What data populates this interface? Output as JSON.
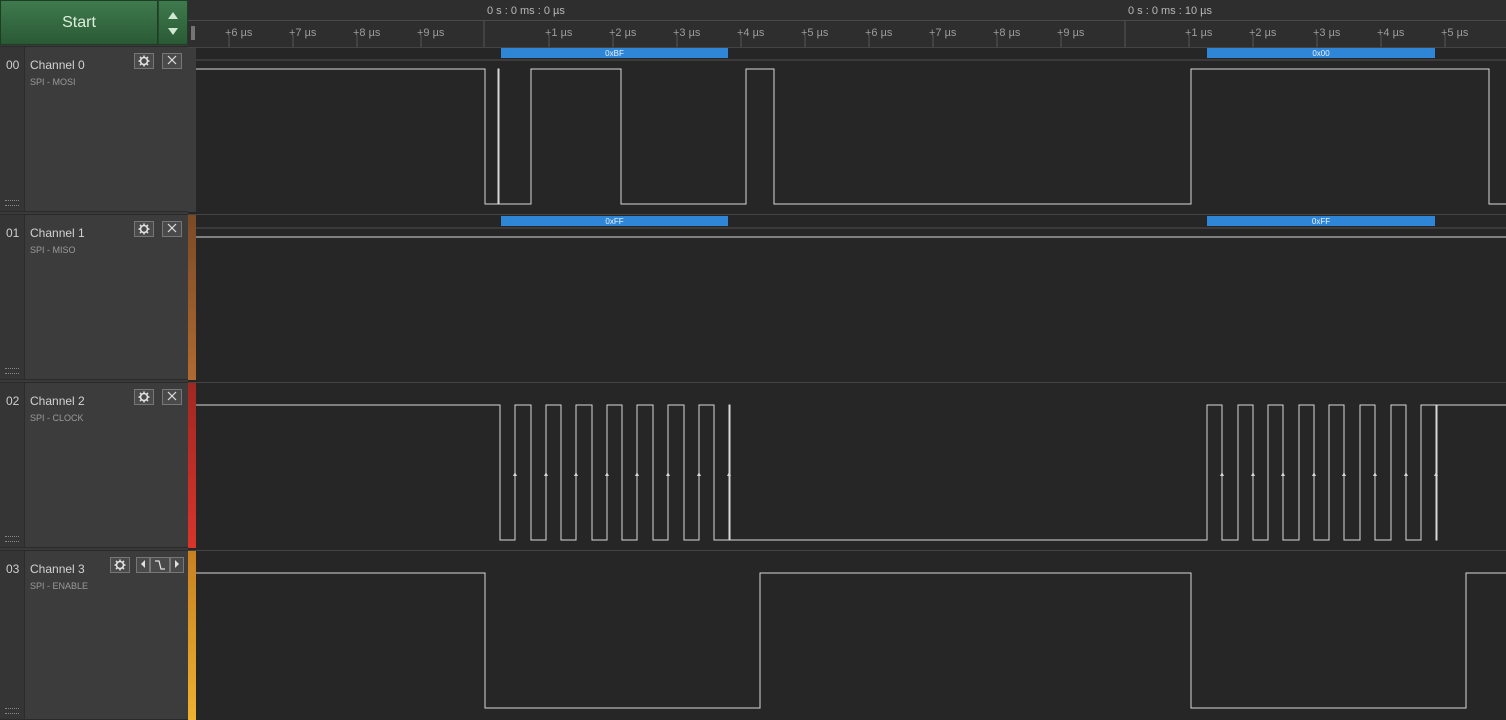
{
  "start_button": {
    "label": "Start"
  },
  "ruler": {
    "time_labels": [
      "0 s : 0 ms : 0 µs",
      "0 s : 0 ms : 10 µs"
    ],
    "ticks": [
      "+6 µs",
      "+7 µs",
      "+8 µs",
      "+9 µs",
      "+1 µs",
      "+2 µs",
      "+3 µs",
      "+4 µs",
      "+5 µs",
      "+6 µs",
      "+7 µs",
      "+8 µs",
      "+9 µs",
      "+1 µs",
      "+2 µs",
      "+3 µs",
      "+4 µs",
      "+5 µs"
    ]
  },
  "channels": [
    {
      "num": "00",
      "name": "Channel 0",
      "sub": "SPI - MOSI",
      "color": "#3c3c3c",
      "decodes": [
        "0xBF",
        "0x00"
      ]
    },
    {
      "num": "01",
      "name": "Channel 1",
      "sub": "SPI - MISO",
      "color": "#9a5a2a",
      "decodes": [
        "0xFF",
        "0xFF"
      ]
    },
    {
      "num": "02",
      "name": "Channel 2",
      "sub": "SPI - CLOCK",
      "color": "#c8322a",
      "decodes": []
    },
    {
      "num": "03",
      "name": "Channel 3",
      "sub": "SPI - ENABLE",
      "color": "#e8a020",
      "decodes": []
    }
  ],
  "colors": {
    "decode_bar": "#2f86d6",
    "signal": "#d8d8d8",
    "start_green": "#3f7a4d"
  },
  "icons": {
    "settings": "gear-icon",
    "close": "close-icon",
    "trigger": "falling-edge-trigger-icon"
  }
}
